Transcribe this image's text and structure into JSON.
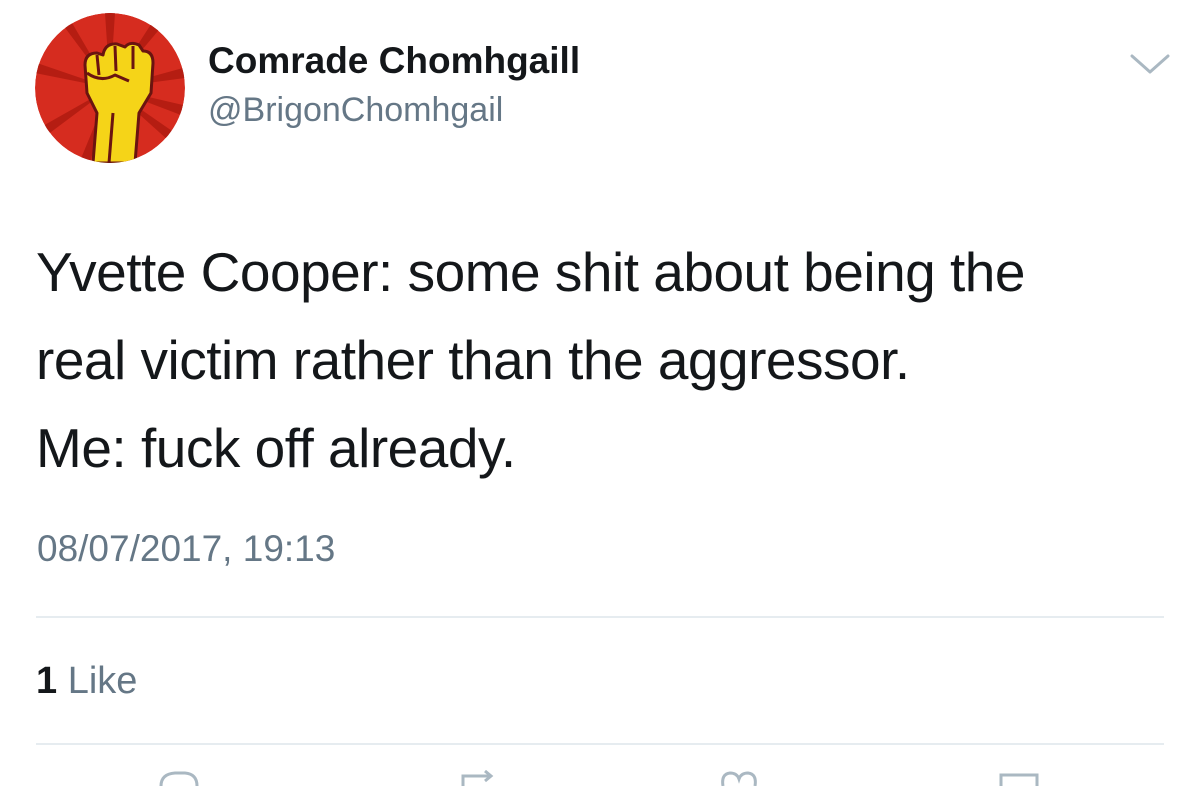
{
  "tweet": {
    "display_name": "Comrade Chomhgaill",
    "handle": "@BrigonChomhgail",
    "text_lines": [
      "Yvette Cooper: some shit about being the",
      "real victim rather than the aggressor.",
      "Me: fuck off already."
    ],
    "timestamp": "08/07/2017, 19:13",
    "likes_count": "1",
    "likes_label": "Like"
  },
  "icons": {
    "avatar": "raised-fist-icon",
    "menu": "chevron-down-icon",
    "actions": [
      "reply-icon",
      "retweet-icon",
      "like-icon",
      "share-icon"
    ]
  },
  "colors": {
    "avatar_red": "#d62c1f",
    "fist_yellow": "#f5d418",
    "secondary_text": "#657786",
    "divider": "#e6ecf0"
  }
}
